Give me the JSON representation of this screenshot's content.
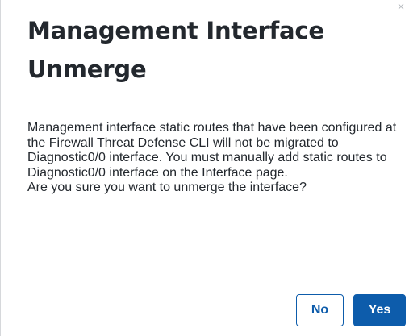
{
  "dialog": {
    "title": "Management Interface Unmerge",
    "message_line1": "Management interface static routes that have been configured at the Firewall Threat Defense CLI will not be migrated to Diagnostic0/0 interface. You must manually add static routes to Diagnostic0/0 interface on the Interface page.",
    "message_line2": "Are you sure you want to unmerge the interface?",
    "no_label": "No",
    "yes_label": "Yes",
    "close_glyph": "×"
  },
  "colors": {
    "primary": "#0d5cab",
    "text": "#23282e",
    "border": "#d6d8db"
  }
}
